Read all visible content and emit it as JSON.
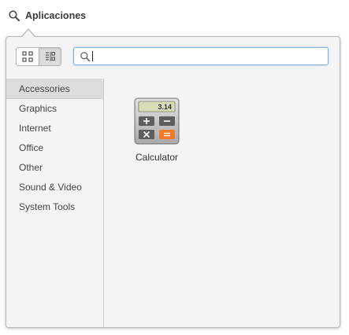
{
  "launcher": {
    "title": "Aplicaciones",
    "icon": "search-icon"
  },
  "toolbar": {
    "view_buttons": [
      {
        "name": "grid-view",
        "icon": "grid-icon",
        "active": false
      },
      {
        "name": "list-view",
        "icon": "list-icon",
        "active": true
      }
    ],
    "search": {
      "value": "",
      "placeholder": "",
      "icon": "search-icon"
    }
  },
  "sidebar": {
    "items": [
      {
        "label": "Accessories",
        "selected": true
      },
      {
        "label": "Graphics",
        "selected": false
      },
      {
        "label": "Internet",
        "selected": false
      },
      {
        "label": "Office",
        "selected": false
      },
      {
        "label": "Other",
        "selected": false
      },
      {
        "label": "Sound & Video",
        "selected": false
      },
      {
        "label": "System Tools",
        "selected": false
      }
    ]
  },
  "apps": [
    {
      "label": "Calculator",
      "icon": "calculator-icon",
      "display": "3.14"
    }
  ],
  "colors": {
    "accent": "#4a90d9",
    "selected_bg": "#dcdcdc",
    "operator_orange": "#f07a2b"
  }
}
